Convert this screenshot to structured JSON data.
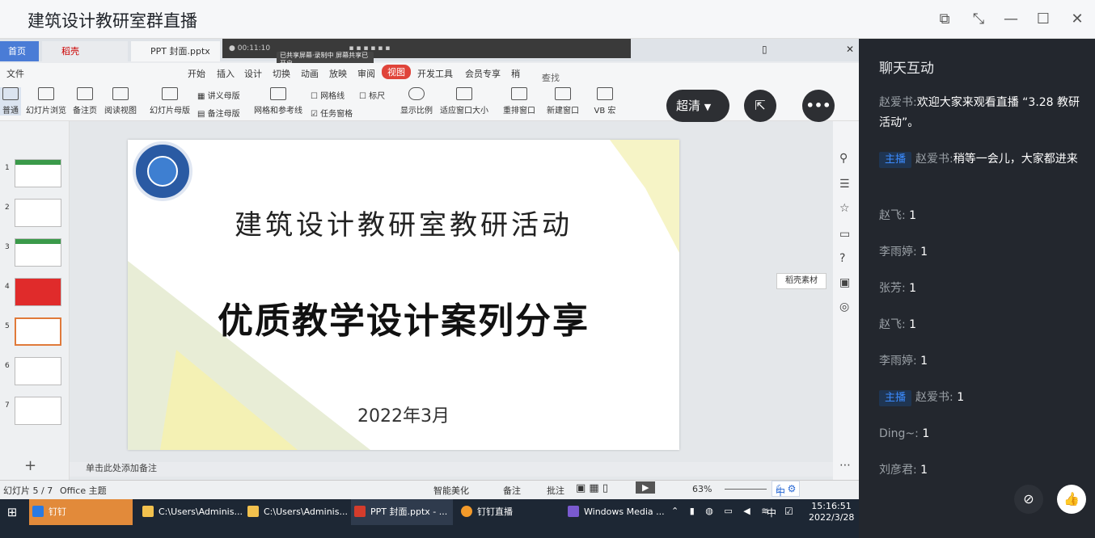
{
  "window": {
    "title": "建筑设计教研室群直播",
    "controls": [
      "restore-mini",
      "collapse",
      "minimize",
      "maximize",
      "close"
    ]
  },
  "overlay": {
    "quality": "超清"
  },
  "wps": {
    "tabs": [
      "首页",
      "稻壳",
      "PPT 封面.pptx"
    ],
    "rec_note": "已共享屏幕·录制中 屏幕共享已开启",
    "menu": [
      "文件",
      "开始",
      "插入",
      "设计",
      "切换",
      "动画",
      "放映",
      "审阅",
      "视图",
      "开发工具",
      "会员专享",
      "稍"
    ],
    "active_menu": "视图",
    "search": "查找命令、搜索模板",
    "ribbon": [
      "普通",
      "幻灯片浏览",
      "备注页",
      "阅读视图",
      "幻灯片母版",
      "讲义母版",
      "备注母版",
      "网格和参考线",
      "网格线",
      "任务窗格",
      "标尺",
      "显示比例",
      "适应窗口大小",
      "重排窗口",
      "新建窗口",
      "VB 宏"
    ],
    "thumb_numbers": [
      "1",
      "2",
      "3",
      "4",
      "5",
      "6",
      "7"
    ],
    "slide": {
      "title": "建筑设计教研室教研活动",
      "subtitle": "优质教学设计案列分享",
      "date": "2022年3月"
    },
    "tooltip": "稻壳素材",
    "notes_hint": "单击此处添加备注",
    "status": {
      "slide_count": "幻灯片 5 / 7",
      "theme": "Office 主题",
      "beautify": "智能美化",
      "notes": "备注",
      "comments": "批注",
      "zoom": "63%"
    }
  },
  "taskbar": {
    "items": [
      "钉钉",
      "C:\\Users\\Adminis...",
      "C:\\Users\\Adminis...",
      "PPT 封面.pptx - ...",
      "钉钉直播",
      "Windows Media ..."
    ],
    "ime": "中",
    "time": "15:16:51",
    "date": "2022/3/28"
  },
  "chat": {
    "title": "聊天互动",
    "host_badge": "主播",
    "messages": [
      {
        "name": "赵爱书:",
        "text": "欢迎大家来观看直播 “3.28 教研活动”。",
        "host": false
      },
      {
        "name": "赵爱书:",
        "text": "稍等一会儿，大家都进来",
        "host": true
      },
      {
        "name": "赵飞:",
        "text": "1",
        "host": false
      },
      {
        "name": "李雨婷:",
        "text": "1",
        "host": false
      },
      {
        "name": "张芳:",
        "text": "1",
        "host": false
      },
      {
        "name": "赵飞:",
        "text": "1",
        "host": false
      },
      {
        "name": "李雨婷:",
        "text": "1",
        "host": false
      },
      {
        "name": "赵爱书:",
        "text": "1",
        "host": true
      },
      {
        "name": "Ding~:",
        "text": "1",
        "host": false
      },
      {
        "name": "刘彦君:",
        "text": "1",
        "host": false
      }
    ]
  }
}
